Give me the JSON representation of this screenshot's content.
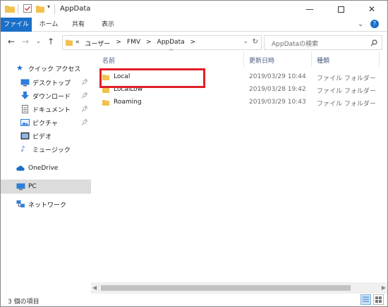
{
  "window": {
    "title": "AppData"
  },
  "ribbon": {
    "tabs": [
      "ファイル",
      "ホーム",
      "共有",
      "表示"
    ]
  },
  "address": {
    "path": [
      "«",
      "ユーザー",
      ">",
      "FMV",
      ">",
      "AppData",
      ">"
    ]
  },
  "search": {
    "placeholder": "AppDataの検索"
  },
  "nav": {
    "quick_access": "クイック アクセス",
    "items": [
      "デスクトップ",
      "ダウンロード",
      "ドキュメント",
      "ピクチャ",
      "ビデオ",
      "ミュージック"
    ],
    "onedrive": "OneDrive",
    "pc": "PC",
    "network": "ネットワーク"
  },
  "columns": {
    "name": "名前",
    "date": "更新日時",
    "type": "種類"
  },
  "files": [
    {
      "name": "Local",
      "date": "2019/03/29 10:44",
      "type": "ファイル フォルダー"
    },
    {
      "name": "LocalLow",
      "date": "2019/03/28 19:42",
      "type": "ファイル フォルダー"
    },
    {
      "name": "Roaming",
      "date": "2019/03/29 10:43",
      "type": "ファイル フォルダー"
    }
  ],
  "status": {
    "count": "3 個の項目"
  },
  "colors": {
    "file_tab": "#1a6fc9",
    "highlight": "#e21e27",
    "folder": "#f2c14e",
    "selected_nav": "#dcdcdc"
  }
}
